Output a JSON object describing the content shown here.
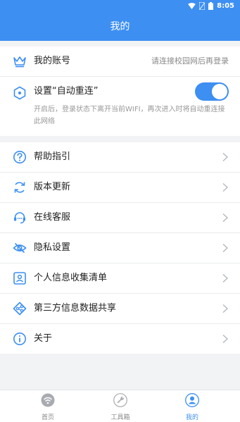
{
  "status_bar": {
    "time": "8:05"
  },
  "header": {
    "title": "我的"
  },
  "account": {
    "label": "我的账号",
    "value": "请连接校园网后再登录"
  },
  "auto_reconnect": {
    "label": "设置“自动重连”",
    "description": "开启后，登录状态下离开当前WIFI，再次进入时将自动重连接此网络",
    "enabled": true
  },
  "menu": {
    "items": [
      {
        "label": "帮助指引",
        "icon": "help-icon"
      },
      {
        "label": "版本更新",
        "icon": "refresh-icon"
      },
      {
        "label": "在线客服",
        "icon": "customer-service-icon"
      },
      {
        "label": "隐私设置",
        "icon": "eye-off-icon"
      },
      {
        "label": "个人信息收集清单",
        "icon": "id-card-icon"
      },
      {
        "label": "第三方信息数据共享",
        "icon": "share-icon"
      },
      {
        "label": "关于",
        "icon": "info-icon"
      }
    ]
  },
  "tabs": [
    {
      "label": "首页",
      "icon": "wifi-icon",
      "active": false
    },
    {
      "label": "工具箱",
      "icon": "wrench-icon",
      "active": false
    },
    {
      "label": "我的",
      "icon": "user-icon",
      "active": true
    }
  ],
  "colors": {
    "accent": "#3d8ff2",
    "background": "#f2f3f5",
    "text": "#222222",
    "muted": "#999999"
  }
}
